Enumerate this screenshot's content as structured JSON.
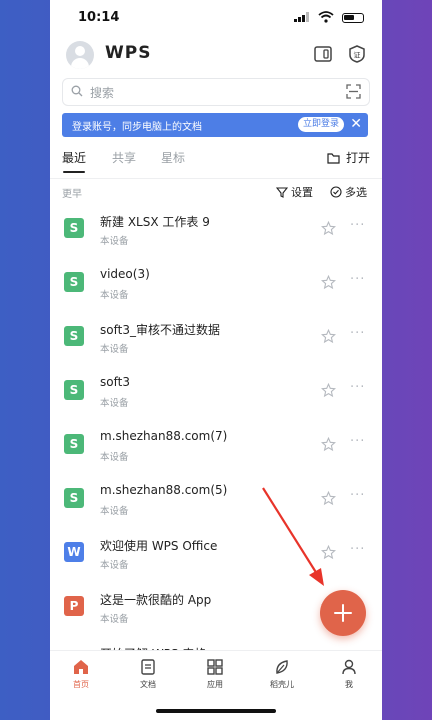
{
  "status_bar": {
    "time": "10:14"
  },
  "header": {
    "logo": "WPS"
  },
  "search": {
    "placeholder": "搜索"
  },
  "banner": {
    "text": "登录账号，同步电脑上的文档",
    "login_label": "立即登录"
  },
  "tabs": [
    {
      "label": "最近",
      "active": true
    },
    {
      "label": "共享",
      "active": false
    },
    {
      "label": "星标",
      "active": false
    }
  ],
  "open_label": "打开",
  "group_label": "更早",
  "setting_label": "设置",
  "multi_select_label": "多选",
  "files": [
    {
      "name": "新建 XLSX 工作表 9",
      "location": "本设备",
      "type": "sheet",
      "icon_letter": "S"
    },
    {
      "name": "video(3)",
      "location": "本设备",
      "type": "sheet",
      "icon_letter": "S"
    },
    {
      "name": "soft3_审核不通过数据",
      "location": "本设备",
      "type": "sheet",
      "icon_letter": "S"
    },
    {
      "name": "soft3",
      "location": "本设备",
      "type": "sheet",
      "icon_letter": "S"
    },
    {
      "name": "m.shezhan88.com(7)",
      "location": "本设备",
      "type": "sheet",
      "icon_letter": "S"
    },
    {
      "name": "m.shezhan88.com(5)",
      "location": "本设备",
      "type": "sheet",
      "icon_letter": "S"
    },
    {
      "name": "欢迎使用 WPS Office",
      "location": "本设备",
      "type": "word",
      "icon_letter": "W"
    },
    {
      "name": "这是一款很酷的 App",
      "location": "本设备",
      "type": "ppt",
      "icon_letter": "P"
    },
    {
      "name": "开始了解 WPS 表格",
      "location": "",
      "type": "sheet",
      "icon_letter": "S"
    }
  ],
  "bottom_nav": [
    {
      "label": "首页",
      "icon": "home-icon",
      "active": true
    },
    {
      "label": "文档",
      "icon": "document-icon",
      "active": false
    },
    {
      "label": "应用",
      "icon": "apps-icon",
      "active": false
    },
    {
      "label": "稻壳儿",
      "icon": "leaf-icon",
      "active": false
    },
    {
      "label": "我",
      "icon": "profile-icon",
      "active": false
    }
  ],
  "colors": {
    "accent": "#e0644a",
    "banner": "#4d7ee6",
    "sheet_icon": "#4cb878",
    "word_icon": "#4e7fe8",
    "ppt_icon": "#e0644a",
    "annotation_arrow": "#e8342a"
  }
}
